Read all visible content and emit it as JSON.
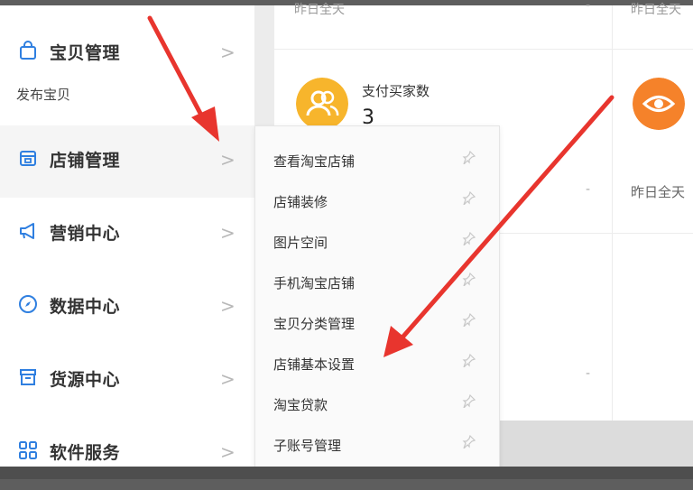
{
  "sidebar": {
    "items": [
      {
        "label": "宝贝管理",
        "icon": "shopping-bag-icon",
        "sub": "发布宝贝"
      },
      {
        "label": "店铺管理",
        "icon": "store-icon"
      },
      {
        "label": "营销中心",
        "icon": "megaphone-icon"
      },
      {
        "label": "数据中心",
        "icon": "compass-icon"
      },
      {
        "label": "货源中心",
        "icon": "archive-box-icon"
      },
      {
        "label": "软件服务",
        "icon": "apps-grid-icon"
      }
    ],
    "chevron": ">"
  },
  "submenu": {
    "items": [
      {
        "label": "查看淘宝店铺"
      },
      {
        "label": "店铺装修"
      },
      {
        "label": "图片空间"
      },
      {
        "label": "手机淘宝店铺"
      },
      {
        "label": "宝贝分类管理"
      },
      {
        "label": "店铺基本设置"
      },
      {
        "label": "淘宝贷款"
      },
      {
        "label": "子账号管理"
      }
    ]
  },
  "main": {
    "top_left_faded": "昨日全天",
    "top_right_faded": "昨日全天",
    "dash": "-",
    "stat1": {
      "label": "支付买家数",
      "value": "3",
      "icon": "users-icon"
    },
    "stat2": {
      "icon": "eye-icon",
      "subtitle": "昨日全天"
    }
  },
  "colors": {
    "accent_yellow": "#f7b52c",
    "accent_orange": "#f5822a",
    "arrow_red": "#e8352e"
  }
}
